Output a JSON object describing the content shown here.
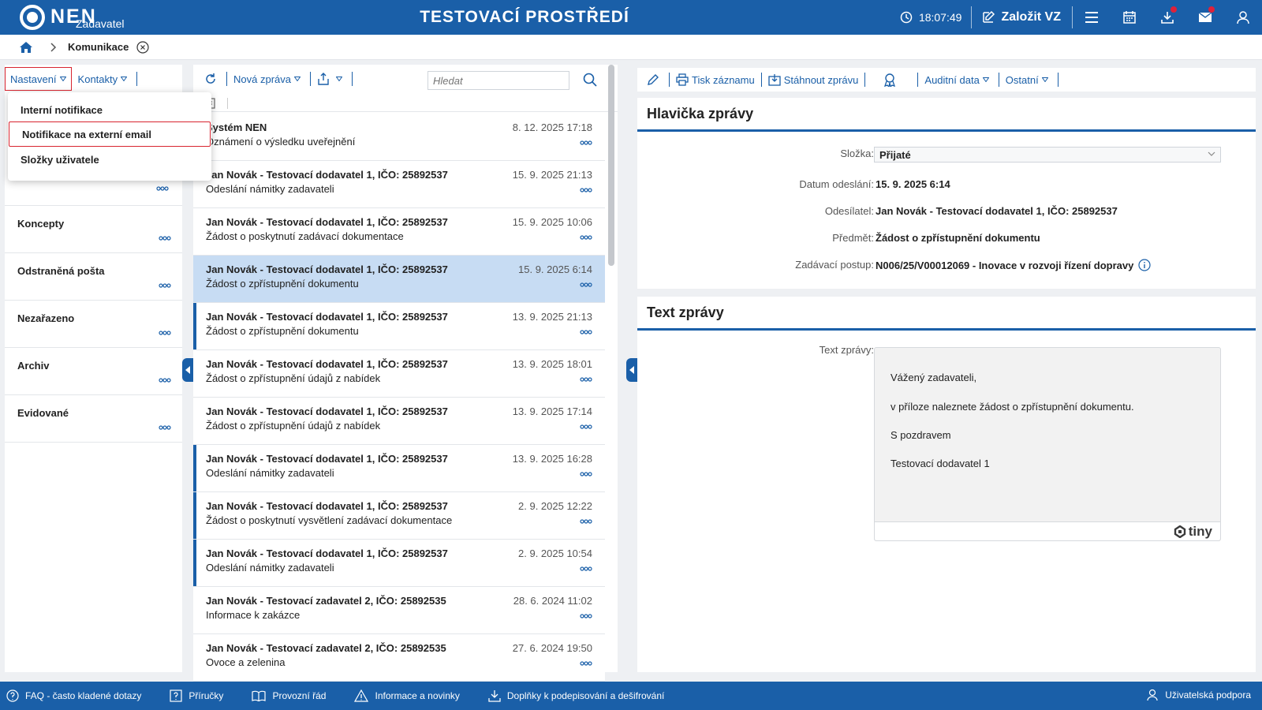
{
  "header": {
    "logo_text": "NEN",
    "logo_subtitle": "Zadavatel",
    "environment_title": "TESTOVACÍ PROSTŘEDÍ",
    "clock": "18:07:49",
    "create_button": "Založit VZ"
  },
  "breadcrumb": {
    "current": "Komunikace"
  },
  "left_panel": {
    "toolbar": {
      "settings": "Nastavení",
      "contacts": "Kontakty"
    },
    "settings_menu": [
      "Interní notifikace",
      "Notifikace na externí email",
      "Složky uživatele"
    ],
    "folders": [
      "Koncepty",
      "Odstraněná pošta",
      "Nezařazeno",
      "Archiv",
      "Evidované"
    ]
  },
  "middle_panel": {
    "toolbar": {
      "new_message": "Nová zpráva"
    },
    "search": {
      "placeholder": "Hledat"
    },
    "messages": [
      {
        "sender": "Systém NEN",
        "subject": "Oznámení o výsledku uveřejnění",
        "date": "8. 12. 2025 17:18",
        "selected": false,
        "unread": false
      },
      {
        "sender": "Jan Novák - Testovací dodavatel 1, IČO: 25892537",
        "subject": "Odeslání námitky zadavateli",
        "date": "15. 9. 2025 21:13",
        "selected": false,
        "unread": false
      },
      {
        "sender": "Jan Novák - Testovací dodavatel 1, IČO: 25892537",
        "subject": "Žádost o poskytnutí zadávací dokumentace",
        "date": "15. 9. 2025 10:06",
        "selected": false,
        "unread": false
      },
      {
        "sender": "Jan Novák - Testovací dodavatel 1, IČO: 25892537",
        "subject": "Žádost o zpřístupnění dokumentu",
        "date": "15. 9. 2025 6:14",
        "selected": true,
        "unread": false
      },
      {
        "sender": "Jan Novák - Testovací dodavatel 1, IČO: 25892537",
        "subject": "Žádost o zpřístupnění dokumentu",
        "date": "13. 9. 2025 21:13",
        "selected": false,
        "unread": true
      },
      {
        "sender": "Jan Novák - Testovací dodavatel 1, IČO: 25892537",
        "subject": "Žádost o zpřístupnění údajů z nabídek",
        "date": "13. 9. 2025 18:01",
        "selected": false,
        "unread": false
      },
      {
        "sender": "Jan Novák - Testovací dodavatel 1, IČO: 25892537",
        "subject": "Žádost o zpřístupnění údajů z nabídek",
        "date": "13. 9. 2025 17:14",
        "selected": false,
        "unread": false
      },
      {
        "sender": "Jan Novák - Testovací dodavatel 1, IČO: 25892537",
        "subject": "Odeslání námitky zadavateli",
        "date": "13. 9. 2025 16:28",
        "selected": false,
        "unread": true
      },
      {
        "sender": "Jan Novák - Testovací dodavatel 1, IČO: 25892537",
        "subject": "Žádost o poskytnutí vysvětlení zadávací dokumentace",
        "date": "2. 9. 2025 12:22",
        "selected": false,
        "unread": true
      },
      {
        "sender": "Jan Novák - Testovací dodavatel 1, IČO: 25892537",
        "subject": "Odeslání námitky zadavateli",
        "date": "2. 9. 2025 10:54",
        "selected": false,
        "unread": true
      },
      {
        "sender": "Jan Novák - Testovací zadavatel 2, IČO: 25892535",
        "subject": "Informace k zakázce",
        "date": "28. 6. 2024 11:02",
        "selected": false,
        "unread": false
      },
      {
        "sender": "Jan Novák - Testovací zadavatel 2, IČO: 25892535",
        "subject": "Ovoce a zelenina",
        "date": "27. 6. 2024 19:50",
        "selected": false,
        "unread": false
      }
    ]
  },
  "right_panel": {
    "toolbar": {
      "print": "Tisk záznamu",
      "download": "Stáhnout zprávu",
      "audit": "Auditní data",
      "other": "Ostatní"
    },
    "header_card": {
      "title": "Hlavička zprávy",
      "folder_label": "Složka:",
      "folder_value": "Přijaté",
      "sent_label": "Datum odeslání:",
      "sent_value": "15. 9. 2025 6:14",
      "sender_label": "Odesílatel:",
      "sender_value": "Jan Novák - Testovací dodavatel 1, IČO: 25892537",
      "subject_label": "Předmět:",
      "subject_value": "Žádost o zpřístupnění dokumentu",
      "procedure_label": "Zadávací postup:",
      "procedure_value": "N006/25/V00012069 - Inovace v rozvoji řízení dopravy"
    },
    "text_card": {
      "title": "Text zprávy",
      "label": "Text zprávy:",
      "lines": [
        "Vážený zadavateli,",
        "v příloze naleznete žádost o zpřístupnění dokumentu.",
        "S pozdravem",
        "Testovací dodavatel 1"
      ],
      "editor_brand": "tiny"
    }
  },
  "footer": {
    "faq": "FAQ - často kladené dotazy",
    "manuals": "Příručky",
    "rules": "Provozní řád",
    "news": "Informace a novinky",
    "addons": "Doplňky k podepisování a dešifrování",
    "support": "Uživatelská podpora"
  },
  "colors": {
    "primary": "#1a5fa8",
    "selected_row": "#c7dcf3",
    "highlight_border": "#d8242f",
    "notification_dot": "#e0213a"
  }
}
